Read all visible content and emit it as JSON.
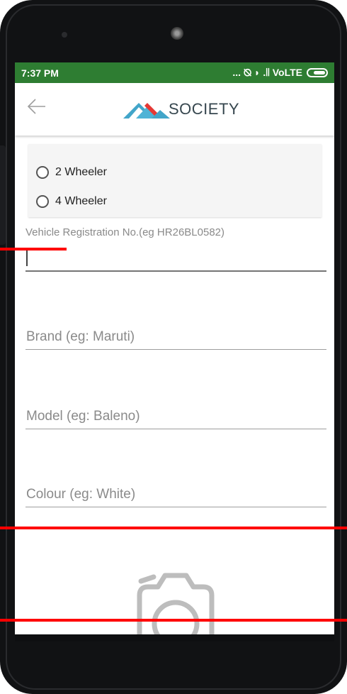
{
  "status_bar": {
    "time": "7:37 PM",
    "indicators": "... ⦰ ◗ .∣∣ VoLTE",
    "background": "#2e7d32"
  },
  "toolbar": {
    "back_icon": "arrow-left-icon",
    "logo_icon": "mountain-logo-icon",
    "logo_text": "SOCIETY"
  },
  "vehicle_type": {
    "options": [
      {
        "label": "2 Wheeler",
        "selected": false
      },
      {
        "label": "4 Wheeler",
        "selected": false
      }
    ]
  },
  "form": {
    "registration": {
      "label": "Vehicle Registration No.(eg HR26BL0582)",
      "value": ""
    },
    "brand": {
      "placeholder": "Brand (eg: Maruti)"
    },
    "model": {
      "placeholder": "Model (eg: Baleno)"
    },
    "colour": {
      "placeholder": "Colour (eg: White)"
    }
  },
  "photo": {
    "icon": "camera-icon"
  },
  "colors": {
    "accent_green": "#2e7d32",
    "logo_blue": "#42a5c9",
    "logo_red": "#e53935",
    "annotation_red": "#ff0000"
  }
}
